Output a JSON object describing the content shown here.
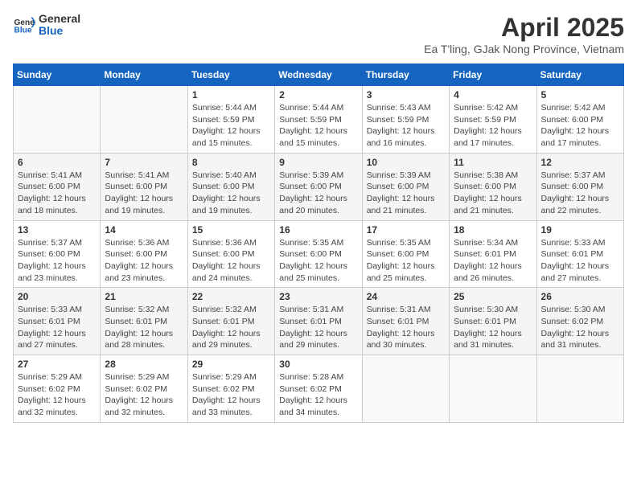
{
  "logo": {
    "line1": "General",
    "line2": "Blue"
  },
  "title": "April 2025",
  "subtitle": "Ea T'ling, GJak Nong Province, Vietnam",
  "days_of_week": [
    "Sunday",
    "Monday",
    "Tuesday",
    "Wednesday",
    "Thursday",
    "Friday",
    "Saturday"
  ],
  "weeks": [
    [
      {
        "num": "",
        "info": ""
      },
      {
        "num": "",
        "info": ""
      },
      {
        "num": "1",
        "info": "Sunrise: 5:44 AM\nSunset: 5:59 PM\nDaylight: 12 hours and 15 minutes."
      },
      {
        "num": "2",
        "info": "Sunrise: 5:44 AM\nSunset: 5:59 PM\nDaylight: 12 hours and 15 minutes."
      },
      {
        "num": "3",
        "info": "Sunrise: 5:43 AM\nSunset: 5:59 PM\nDaylight: 12 hours and 16 minutes."
      },
      {
        "num": "4",
        "info": "Sunrise: 5:42 AM\nSunset: 5:59 PM\nDaylight: 12 hours and 17 minutes."
      },
      {
        "num": "5",
        "info": "Sunrise: 5:42 AM\nSunset: 6:00 PM\nDaylight: 12 hours and 17 minutes."
      }
    ],
    [
      {
        "num": "6",
        "info": "Sunrise: 5:41 AM\nSunset: 6:00 PM\nDaylight: 12 hours and 18 minutes."
      },
      {
        "num": "7",
        "info": "Sunrise: 5:41 AM\nSunset: 6:00 PM\nDaylight: 12 hours and 19 minutes."
      },
      {
        "num": "8",
        "info": "Sunrise: 5:40 AM\nSunset: 6:00 PM\nDaylight: 12 hours and 19 minutes."
      },
      {
        "num": "9",
        "info": "Sunrise: 5:39 AM\nSunset: 6:00 PM\nDaylight: 12 hours and 20 minutes."
      },
      {
        "num": "10",
        "info": "Sunrise: 5:39 AM\nSunset: 6:00 PM\nDaylight: 12 hours and 21 minutes."
      },
      {
        "num": "11",
        "info": "Sunrise: 5:38 AM\nSunset: 6:00 PM\nDaylight: 12 hours and 21 minutes."
      },
      {
        "num": "12",
        "info": "Sunrise: 5:37 AM\nSunset: 6:00 PM\nDaylight: 12 hours and 22 minutes."
      }
    ],
    [
      {
        "num": "13",
        "info": "Sunrise: 5:37 AM\nSunset: 6:00 PM\nDaylight: 12 hours and 23 minutes."
      },
      {
        "num": "14",
        "info": "Sunrise: 5:36 AM\nSunset: 6:00 PM\nDaylight: 12 hours and 23 minutes."
      },
      {
        "num": "15",
        "info": "Sunrise: 5:36 AM\nSunset: 6:00 PM\nDaylight: 12 hours and 24 minutes."
      },
      {
        "num": "16",
        "info": "Sunrise: 5:35 AM\nSunset: 6:00 PM\nDaylight: 12 hours and 25 minutes."
      },
      {
        "num": "17",
        "info": "Sunrise: 5:35 AM\nSunset: 6:00 PM\nDaylight: 12 hours and 25 minutes."
      },
      {
        "num": "18",
        "info": "Sunrise: 5:34 AM\nSunset: 6:01 PM\nDaylight: 12 hours and 26 minutes."
      },
      {
        "num": "19",
        "info": "Sunrise: 5:33 AM\nSunset: 6:01 PM\nDaylight: 12 hours and 27 minutes."
      }
    ],
    [
      {
        "num": "20",
        "info": "Sunrise: 5:33 AM\nSunset: 6:01 PM\nDaylight: 12 hours and 27 minutes."
      },
      {
        "num": "21",
        "info": "Sunrise: 5:32 AM\nSunset: 6:01 PM\nDaylight: 12 hours and 28 minutes."
      },
      {
        "num": "22",
        "info": "Sunrise: 5:32 AM\nSunset: 6:01 PM\nDaylight: 12 hours and 29 minutes."
      },
      {
        "num": "23",
        "info": "Sunrise: 5:31 AM\nSunset: 6:01 PM\nDaylight: 12 hours and 29 minutes."
      },
      {
        "num": "24",
        "info": "Sunrise: 5:31 AM\nSunset: 6:01 PM\nDaylight: 12 hours and 30 minutes."
      },
      {
        "num": "25",
        "info": "Sunrise: 5:30 AM\nSunset: 6:01 PM\nDaylight: 12 hours and 31 minutes."
      },
      {
        "num": "26",
        "info": "Sunrise: 5:30 AM\nSunset: 6:02 PM\nDaylight: 12 hours and 31 minutes."
      }
    ],
    [
      {
        "num": "27",
        "info": "Sunrise: 5:29 AM\nSunset: 6:02 PM\nDaylight: 12 hours and 32 minutes."
      },
      {
        "num": "28",
        "info": "Sunrise: 5:29 AM\nSunset: 6:02 PM\nDaylight: 12 hours and 32 minutes."
      },
      {
        "num": "29",
        "info": "Sunrise: 5:29 AM\nSunset: 6:02 PM\nDaylight: 12 hours and 33 minutes."
      },
      {
        "num": "30",
        "info": "Sunrise: 5:28 AM\nSunset: 6:02 PM\nDaylight: 12 hours and 34 minutes."
      },
      {
        "num": "",
        "info": ""
      },
      {
        "num": "",
        "info": ""
      },
      {
        "num": "",
        "info": ""
      }
    ]
  ]
}
